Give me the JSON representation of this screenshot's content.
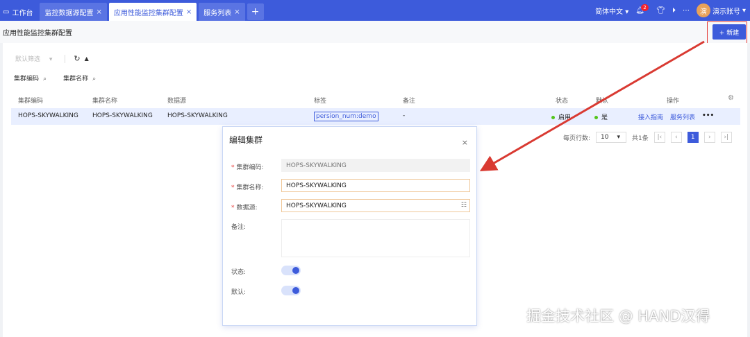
{
  "topbar": {
    "tabs": [
      {
        "label": "工作台"
      },
      {
        "label": "监控数据源配置"
      },
      {
        "label": "应用性能监控集群配置"
      },
      {
        "label": "服务列表"
      }
    ],
    "close_glyph": "×",
    "add_glyph": "+",
    "language": "简体中文",
    "notification_count": "2",
    "avatar_text": "演",
    "user_name": "演示账号",
    "more": "⋯"
  },
  "page": {
    "title": "应用性能监控集群配置",
    "new_button": "+ 新建"
  },
  "filter": {
    "default_filter": "默认筛选",
    "fields": [
      "集群编码",
      "集群名称"
    ]
  },
  "table": {
    "headers": [
      "集群编码",
      "集群名称",
      "数据源",
      "标签",
      "备注",
      "状态",
      "默认",
      "操作"
    ],
    "rows": [
      {
        "code": "HOPS-SKYWALKING",
        "name": "HOPS-SKYWALKING",
        "datasource": "HOPS-SKYWALKING",
        "tag": "persion_num:demo",
        "remark": "-",
        "status": "启用",
        "default": "是",
        "action_guide": "接入指南",
        "action_services": "服务列表",
        "action_more": "•••"
      }
    ]
  },
  "pager": {
    "rows_per_page_label": "每页行数:",
    "page_size": "10",
    "total": "共1条",
    "current_page": "1"
  },
  "modal": {
    "title": "编辑集群",
    "close": "×",
    "code_label": "集群编码:",
    "code_value": "HOPS-SKYWALKING",
    "name_label": "集群名称:",
    "name_value": "HOPS-SKYWALKING",
    "datasource_label": "数据源:",
    "datasource_value": "HOPS-SKYWALKING",
    "remark_label": "备注:",
    "status_label": "状态:",
    "default_label": "默认:",
    "status_on": true,
    "default_on": true
  },
  "watermark": "掘金技术社区 @ HAND汉得",
  "colors": {
    "primary": "#3d5bdb",
    "arrow": "#d93a32"
  }
}
